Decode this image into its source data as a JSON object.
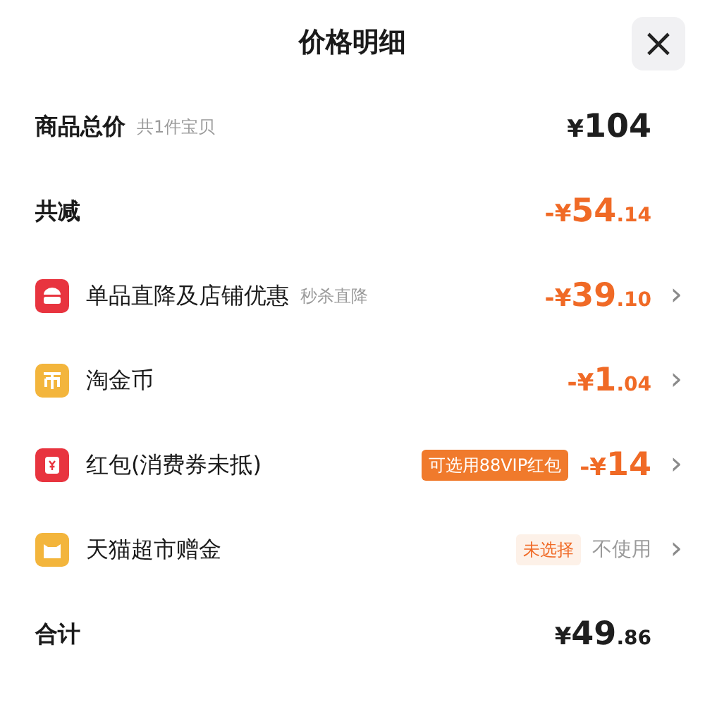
{
  "title": "价格明细",
  "close": "×",
  "rows": [
    {
      "kind": "total",
      "label": "商品总价",
      "note": "共1件宝贝",
      "amount": "¥104"
    },
    {
      "kind": "reduction",
      "label": "共减",
      "amount": "-¥54.14"
    },
    {
      "kind": "discount",
      "color": "#e8343f",
      "label": "单品直降及店铺优惠",
      "note": "秒杀直降",
      "amount": "-¥39.10",
      "chevron": "›"
    },
    {
      "kind": "discount",
      "color": "#f3b53c",
      "label": "淘金币",
      "amount": "-¥1.04",
      "chevron": "›"
    },
    {
      "kind": "discount",
      "color": "#e8343f",
      "label": "红包(消费券未抵)",
      "tag": "可选用88VIP红包",
      "amount": "-¥14",
      "chevron": "›"
    },
    {
      "kind": "unused",
      "color": "#f3b53c",
      "label": "天猫超市赠金",
      "tag": "未选择",
      "amount": "不使用",
      "chevron": "›"
    },
    {
      "kind": "total",
      "label": "合计",
      "amount": "¥49.86"
    }
  ]
}
